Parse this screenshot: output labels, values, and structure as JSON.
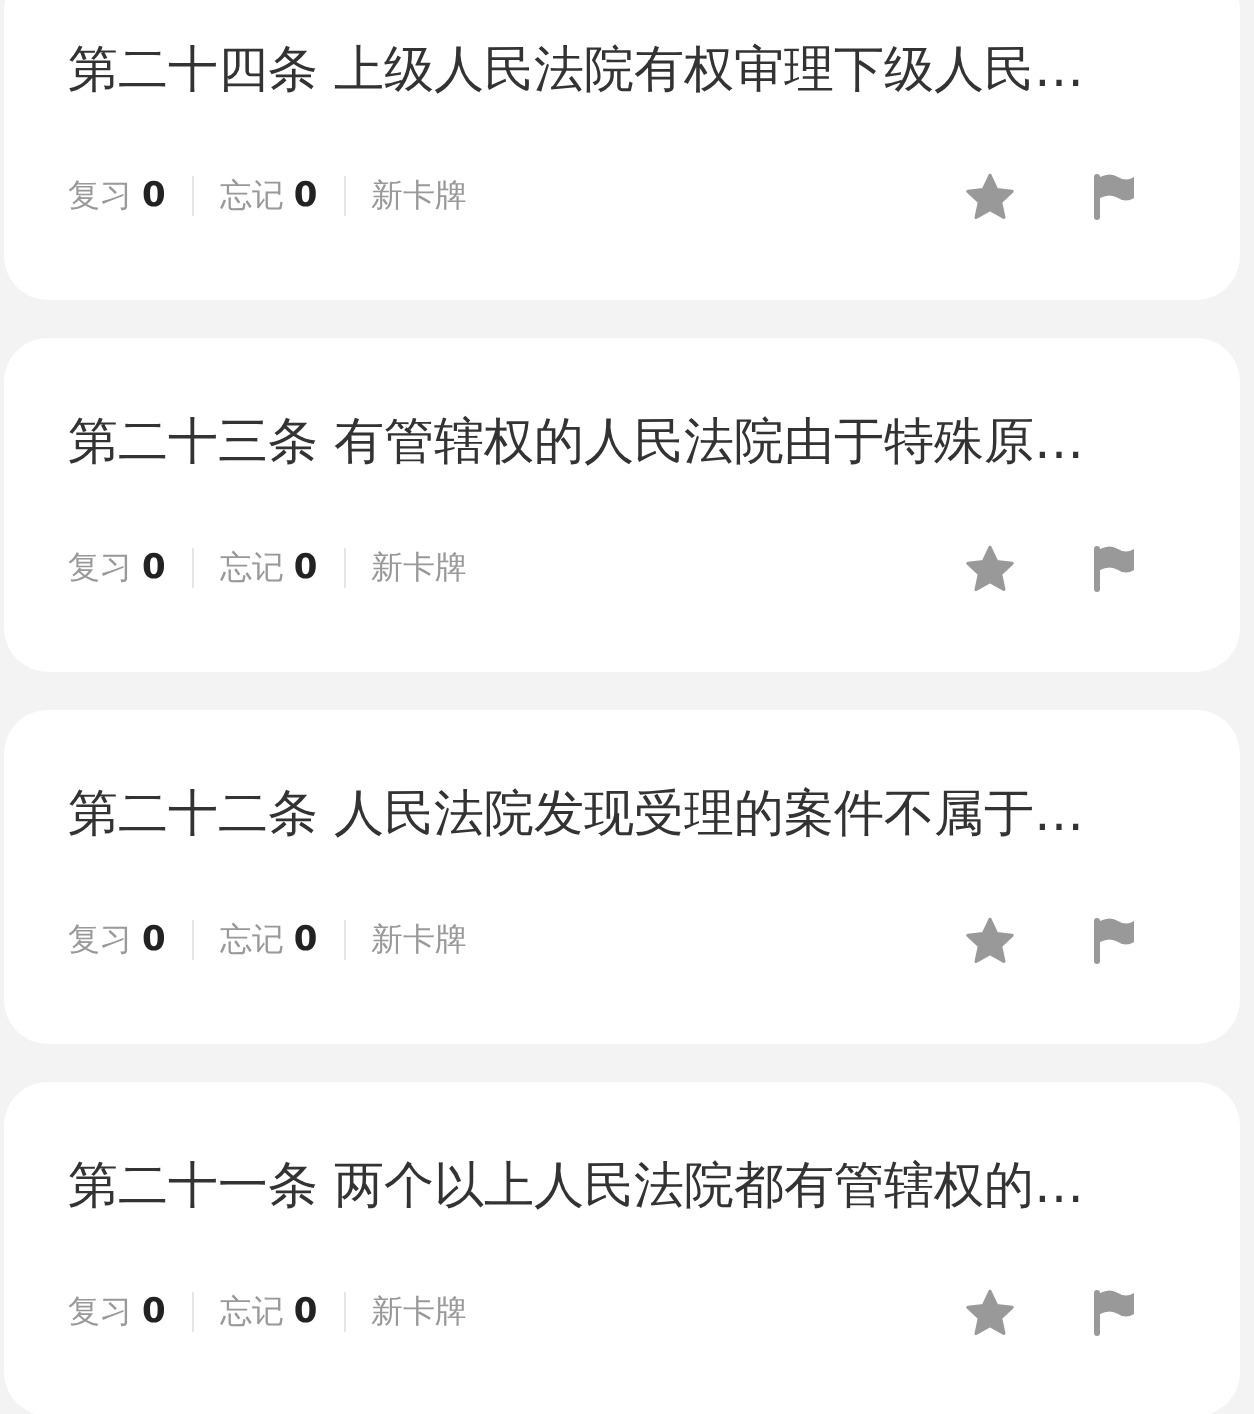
{
  "cards": [
    {
      "title": "第二十四条 上级人民法院有权审理下级人民…",
      "review_label": "复习",
      "review_count": "0",
      "forget_label": "忘记",
      "forget_count": "0",
      "status": "新卡牌"
    },
    {
      "title": "第二十三条 有管辖权的人民法院由于特殊原…",
      "review_label": "复习",
      "review_count": "0",
      "forget_label": "忘记",
      "forget_count": "0",
      "status": "新卡牌"
    },
    {
      "title": "第二十二条 人民法院发现受理的案件不属于…",
      "review_label": "复习",
      "review_count": "0",
      "forget_label": "忘记",
      "forget_count": "0",
      "status": "新卡牌"
    },
    {
      "title": "第二十一条 两个以上人民法院都有管辖权的…",
      "review_label": "复习",
      "review_count": "0",
      "forget_label": "忘记",
      "forget_count": "0",
      "status": "新卡牌"
    }
  ]
}
